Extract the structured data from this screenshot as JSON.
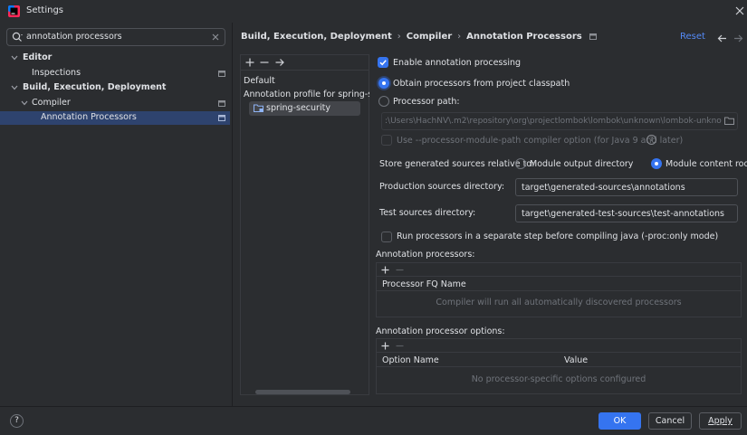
{
  "window": {
    "title": "Settings"
  },
  "search": {
    "value": "annotation processors"
  },
  "tree": [
    {
      "label": "Editor"
    },
    {
      "label": "Inspections"
    },
    {
      "label": "Build, Execution, Deployment"
    },
    {
      "label": "Compiler"
    },
    {
      "label": "Annotation Processors"
    }
  ],
  "header": {
    "breadcrumb": [
      "Build, Execution, Deployment",
      "Compiler",
      "Annotation Processors"
    ],
    "reset_label": "Reset"
  },
  "profiles": {
    "default_label": "Default",
    "profile_label": "Annotation profile for spring-security",
    "module_label": "spring-security"
  },
  "settings": {
    "enable_label": "Enable annotation processing",
    "enable_checked": true,
    "obtain_label": "Obtain processors from project classpath",
    "processor_path_label": "Processor path:",
    "processor_path_value": ":\\Users\\HachNV\\.m2\\repository\\org\\projectlombok\\lombok\\unknown\\lombok-unknown.jar",
    "module_path_label": "Use --processor-module-path compiler option (for Java 9 and later)",
    "store_label": "Store generated sources relative to:",
    "module_output_label": "Module output directory",
    "module_content_label": "Module content root",
    "production_label": "Production sources directory:",
    "production_value": "target\\generated-sources\\annotations",
    "test_label": "Test sources directory:",
    "test_value": "target\\generated-test-sources\\test-annotations",
    "separate_step_label": "Run processors in a separate step before compiling java (-proc:only mode)"
  },
  "annotation_processors": {
    "section_label": "Annotation processors:",
    "column": "Processor FQ Name",
    "empty_text": "Compiler will run all automatically discovered processors"
  },
  "processor_options": {
    "section_label": "Annotation processor options:",
    "columns": [
      "Option Name",
      "Value"
    ],
    "empty_text": "No processor-specific options configured"
  },
  "footer": {
    "help_label": "?",
    "ok_label": "OK",
    "cancel_label": "Cancel",
    "apply_label": "Apply"
  },
  "colors": {
    "accent": "#3574f0",
    "link": "#548af7",
    "selection": "#2e436e",
    "background": "#2b2d30"
  }
}
